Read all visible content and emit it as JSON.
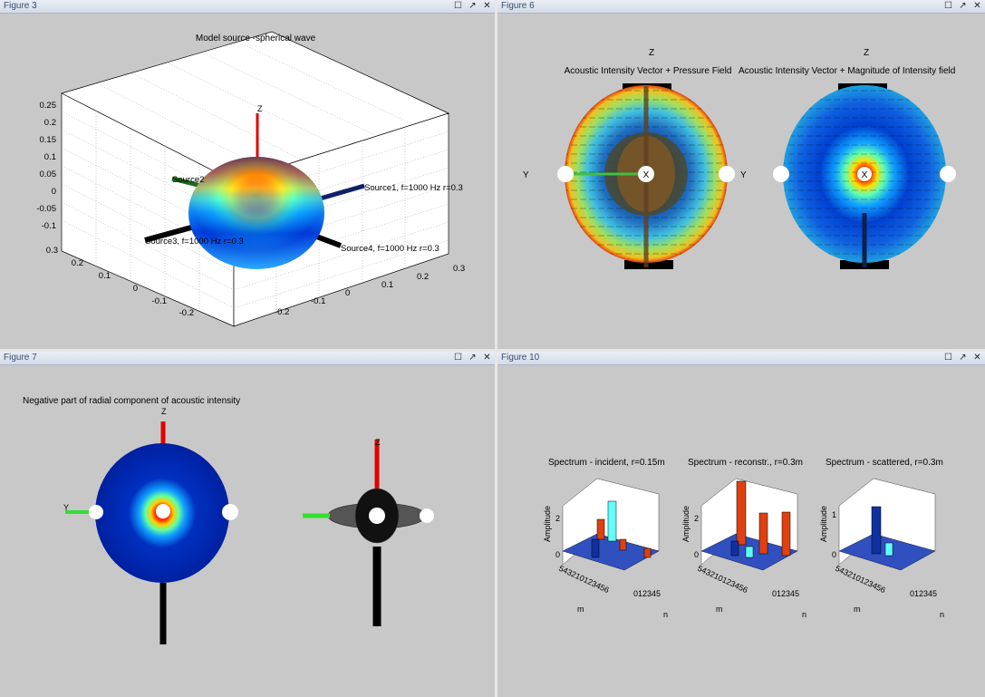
{
  "figures": {
    "fig3": {
      "title": "Figure 3",
      "plot_title": "Model source -spherical wave",
      "z_label": "Z",
      "z_ticks": [
        "0.25",
        "0.2",
        "0.15",
        "0.1",
        "0.05",
        "0",
        "-0.05",
        "-0.1"
      ],
      "x_ticks": [
        "0.3",
        "0.2",
        "0.1",
        "0",
        "-0.1",
        "-0.2"
      ],
      "y_ticks": [
        "-0.2",
        "-0.1",
        "0",
        "0.1",
        "0.2",
        "0.3"
      ],
      "labels": {
        "s1": "Source1, f=1000 Hz r=0.3",
        "s2": "Source2",
        "s3": "Source3, f=1000 Hz r=0.3",
        "s4": "Source4, f=1000 Hz r=0.3"
      }
    },
    "fig6": {
      "title": "Figure 6",
      "left_title": "Acoustic Intensity Vector + Pressure Field",
      "right_title": "Acoustic Intensity Vector + Magnitude of Intensity field",
      "z_label": "Z",
      "y_label": "Y",
      "x_label": "X"
    },
    "fig7": {
      "title": "Figure 7",
      "plot_title": "Negative part of radial component of acoustic intensity",
      "z_label": "Z",
      "y_label": "Y"
    },
    "fig10": {
      "title": "Figure 10",
      "panels": [
        {
          "title": "Spectrum - incident, r=0.15m",
          "ylabel": "Amplitude",
          "yticks": [
            "2",
            "0"
          ],
          "m_ticks": "543210123456",
          "n_ticks": "012345",
          "m_label": "m",
          "n_label": "n"
        },
        {
          "title": "Spectrum - reconstr., r=0.3m",
          "ylabel": "Amplitude",
          "yticks": [
            "2",
            "0"
          ],
          "m_ticks": "543210123456",
          "n_ticks": "012345",
          "m_label": "m",
          "n_label": "n"
        },
        {
          "title": "Spectrum - scattered, r=0.3m",
          "ylabel": "Amplitude",
          "yticks": [
            "1",
            "0"
          ],
          "m_ticks": "543210123456",
          "n_ticks": "012345",
          "m_label": "m",
          "n_label": "n"
        }
      ]
    }
  },
  "window_buttons": {
    "dock": "☐",
    "undock": "↗",
    "close": "✕"
  }
}
